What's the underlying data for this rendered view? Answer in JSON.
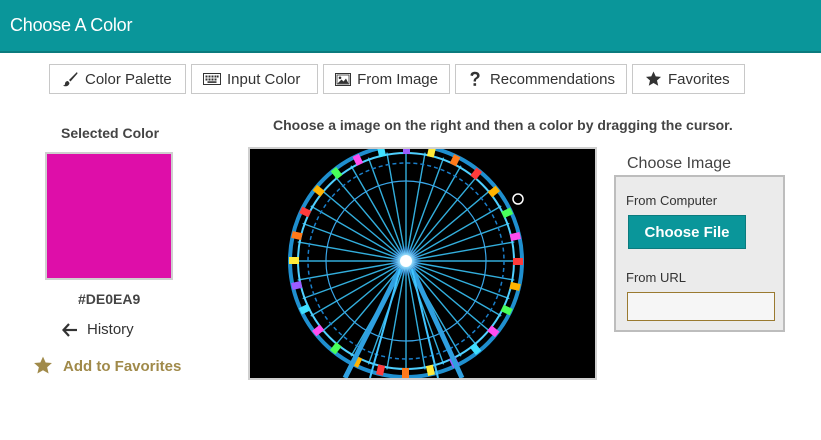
{
  "header": {
    "title": "Choose A Color"
  },
  "tabs": [
    {
      "label": "Color Palette",
      "icon": "brush-icon"
    },
    {
      "label": "Input Color",
      "icon": "keyboard-icon"
    },
    {
      "label": "From Image",
      "icon": "image-icon"
    },
    {
      "label": "Recommendations",
      "icon": "question-icon"
    },
    {
      "label": "Favorites",
      "icon": "star-icon"
    }
  ],
  "selected": {
    "label": "Selected Color",
    "hex": "#DE0EA9",
    "color": "#DE0EA9"
  },
  "history": {
    "label": "History"
  },
  "favorites": {
    "label": "Add to Favorites"
  },
  "main": {
    "instruction": "Choose a image on the right and then a color by dragging the cursor."
  },
  "choose_image": {
    "legend": "Choose Image",
    "from_computer": "From Computer",
    "file_button": "Choose File",
    "from_url": "From URL",
    "url_value": ""
  },
  "colors": {
    "header": "#0A969A",
    "button": "#0A969A",
    "favorites_gold": "#A08A4A"
  }
}
